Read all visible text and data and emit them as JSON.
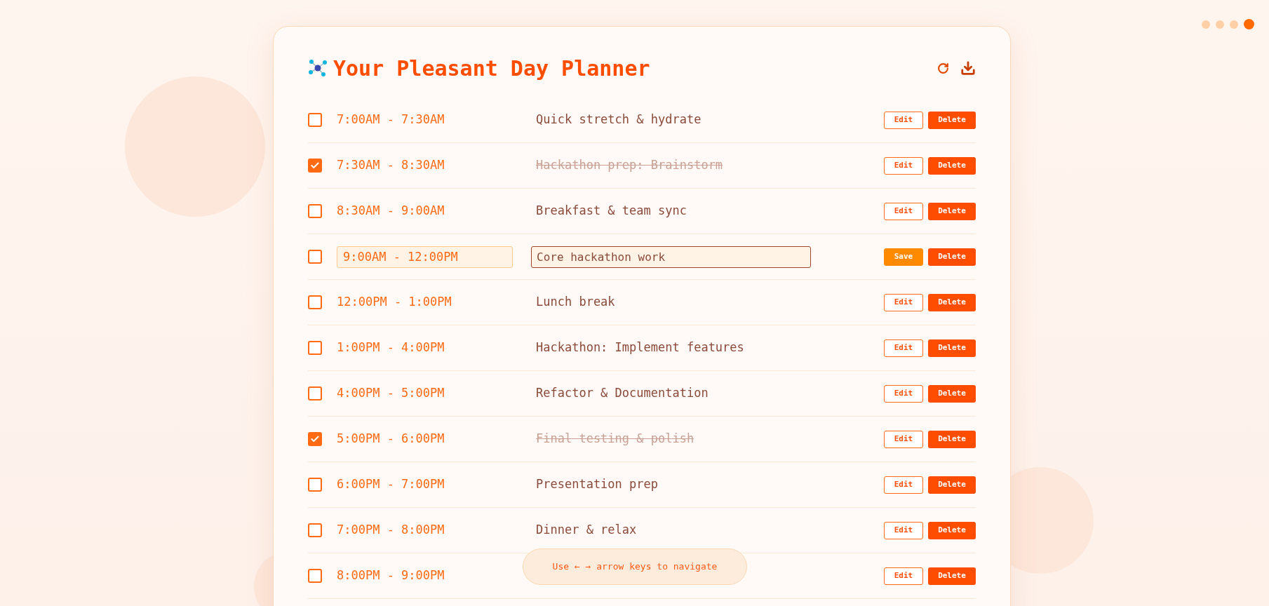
{
  "page_dots": [
    {
      "selected": false
    },
    {
      "selected": false
    },
    {
      "selected": false
    },
    {
      "selected": true
    }
  ],
  "planner": {
    "title": "Your Pleasant Day Planner",
    "rows": [
      {
        "time": "7:00AM - 7:30AM",
        "task": "Quick stretch & hydrate",
        "checked": false,
        "editing": false,
        "edit_label": "Edit",
        "delete_label": "Delete"
      },
      {
        "time": "7:30AM - 8:30AM",
        "task": "Hackathon prep: Brainstorm",
        "checked": true,
        "editing": false,
        "edit_label": "Edit",
        "delete_label": "Delete"
      },
      {
        "time": "8:30AM - 9:00AM",
        "task": "Breakfast & team sync",
        "checked": false,
        "editing": false,
        "edit_label": "Edit",
        "delete_label": "Delete"
      },
      {
        "time": "9:00AM - 12:00PM",
        "task": "Core hackathon work",
        "checked": false,
        "editing": true,
        "edit_label": "Save",
        "delete_label": "Delete"
      },
      {
        "time": "12:00PM - 1:00PM",
        "task": "Lunch break",
        "checked": false,
        "editing": false,
        "edit_label": "Edit",
        "delete_label": "Delete"
      },
      {
        "time": "1:00PM - 4:00PM",
        "task": "Hackathon: Implement features",
        "checked": false,
        "editing": false,
        "edit_label": "Edit",
        "delete_label": "Delete"
      },
      {
        "time": "4:00PM - 5:00PM",
        "task": "Refactor & Documentation",
        "checked": false,
        "editing": false,
        "edit_label": "Edit",
        "delete_label": "Delete"
      },
      {
        "time": "5:00PM - 6:00PM",
        "task": "Final testing & polish",
        "checked": true,
        "editing": false,
        "edit_label": "Edit",
        "delete_label": "Delete"
      },
      {
        "time": "6:00PM - 7:00PM",
        "task": "Presentation prep",
        "checked": false,
        "editing": false,
        "edit_label": "Edit",
        "delete_label": "Delete"
      },
      {
        "time": "7:00PM - 8:00PM",
        "task": "Dinner & relax",
        "checked": false,
        "editing": false,
        "edit_label": "Edit",
        "delete_label": "Delete"
      },
      {
        "time": "8:00PM - 9:00PM",
        "checked": false,
        "editing": false,
        "edit_label": "Edit",
        "delete_label": "Delete"
      }
    ],
    "hint": "Use ← → arrow keys to navigate"
  }
}
